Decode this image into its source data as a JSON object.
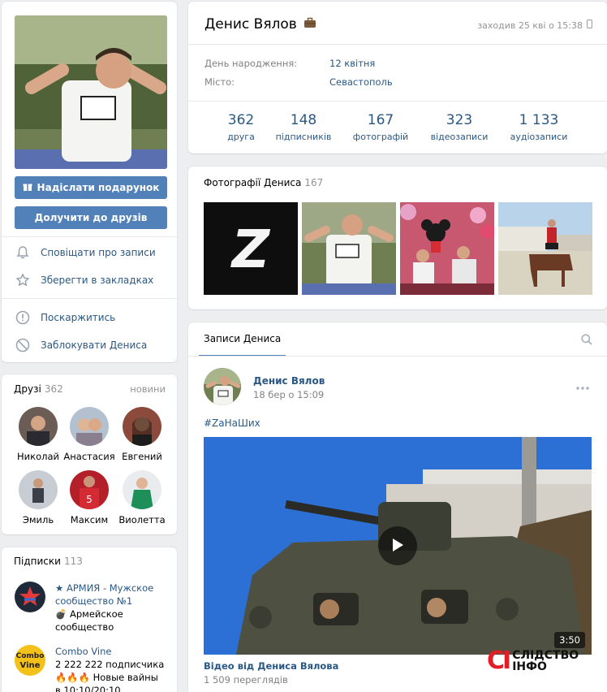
{
  "profile": {
    "name": "Денис Вялов",
    "last_seen": "заходив 25 кві о 15:38",
    "birthday_label": "День народження:",
    "birthday_value": "12 квітня",
    "city_label": "Місто:",
    "city_value": "Севастополь"
  },
  "actions": {
    "gift_button": "Надіслати подарунок",
    "add_friend_button": "Долучити до друзів",
    "notify": "Сповіщати про записи",
    "bookmark": "Зберегти в закладках",
    "report": "Поскаржитись",
    "block": "Заблокувати Дениса"
  },
  "stats": [
    {
      "value": "362",
      "label": "друга"
    },
    {
      "value": "148",
      "label": "підписників"
    },
    {
      "value": "167",
      "label": "фотографій"
    },
    {
      "value": "323",
      "label": "відеозаписи"
    },
    {
      "value": "1 133",
      "label": "аудіозаписи"
    }
  ],
  "photos": {
    "title": "Фотографії Дениса",
    "count": "167",
    "tile1_glyph": "Z"
  },
  "friends": {
    "title": "Друзі",
    "count": "362",
    "link": "новини",
    "items": [
      {
        "name": "Николай"
      },
      {
        "name": "Анастасия"
      },
      {
        "name": "Евгений"
      },
      {
        "name": "Эмиль"
      },
      {
        "name": "Максим"
      },
      {
        "name": "Виолетта"
      }
    ]
  },
  "subscriptions": {
    "title": "Підписки",
    "count": "113",
    "items": [
      {
        "title": "★ АРМИЯ - Мужское сообщество №1",
        "desc": "💣 Армейское сообщество"
      },
      {
        "title": "Combo Vine",
        "desc": "2 222 222 подписчика 🔥🔥🔥 Новые вайны в 10:10/20:10"
      }
    ]
  },
  "wall": {
    "tab": "Записи Дениса",
    "post": {
      "author": "Денис Вялов",
      "date": "18 бер о 15:09",
      "hashtag": "#ZаНаШих",
      "video_duration": "3:50",
      "video_title": "Відео від Дениса Вялова",
      "views": "1 509 переглядів"
    }
  },
  "watermark": {
    "logo": "СІ",
    "line1": "СЛІДСТВО",
    "line2": "ІНФО"
  },
  "colors": {
    "accent": "#5181b8",
    "link": "#2a5885",
    "bg": "#edeef0",
    "watermark_red": "#e31e24"
  }
}
